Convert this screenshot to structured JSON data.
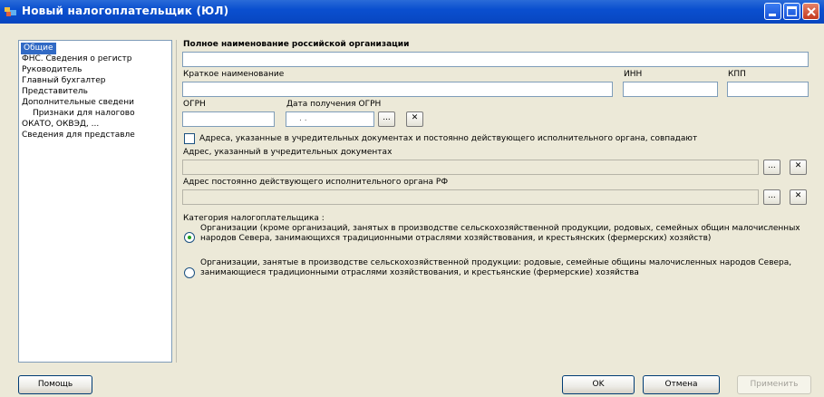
{
  "window": {
    "title": "Новый налогоплательщик (ЮЛ)",
    "colors": {
      "titlebar": "#0a4fcf",
      "selection": "#316ac5"
    }
  },
  "nav": {
    "items": [
      {
        "label": "Общие",
        "selected": true
      },
      {
        "label": "ФНС. Сведения о регистр"
      },
      {
        "label": "Руководитель"
      },
      {
        "label": "Главный бухгалтер"
      },
      {
        "label": "Представитель"
      },
      {
        "label": "Дополнительные сведени"
      },
      {
        "label": "Признаки для налогово"
      },
      {
        "label": "ОКАТО, ОКВЭД, ..."
      },
      {
        "label": "Сведения для представле"
      }
    ]
  },
  "form": {
    "full_name_label": "Полное наименование российской организации",
    "short_name_label": "Краткое наименование",
    "inn_label": "ИНН",
    "kpp_label": "КПП",
    "ogrn_label": "ОГРН",
    "ogrn_date_label": "Дата получения ОГРН",
    "ogrn_date_value": ". .",
    "ellipsis": "...",
    "clear": "✕",
    "same_address_label": "Адреса, указанные в учредительных документах и постоянно действующего исполнительного органа, совпадают",
    "address_constituent_label": "Адрес, указанный в учредительных документах",
    "address_exec_label": "Адрес постоянно действующего исполнительного органа РФ",
    "category_label": "Категория налогоплательщика :",
    "category_options": [
      {
        "label": "Организации (кроме организаций, занятых в производстве сельскохозяйственной продукции, родовых, семейных общин малочисленных народов Севера, занимающихся традиционными отраслями хозяйствования, и крестьянских (фермерских) хозяйств)",
        "selected": true
      },
      {
        "label": "Организации, занятые в производстве сельскохозяйственной продукции: родовые, семейные общины малочисленных народов Севера, занимающиеся традиционными отраслями хозяйствования, и крестьянские (фермерские) хозяйства",
        "selected": false
      }
    ]
  },
  "footer": {
    "help": "Помощь",
    "ok": "OK",
    "cancel": "Отмена",
    "apply": "Применить"
  }
}
